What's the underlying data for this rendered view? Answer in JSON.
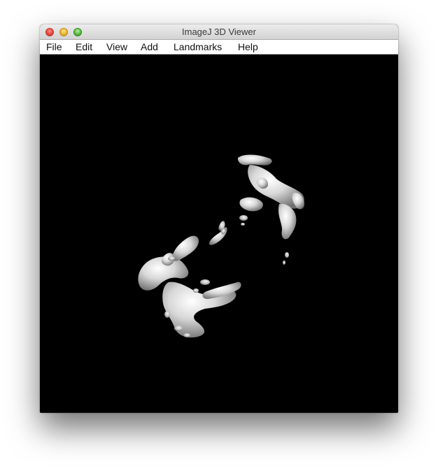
{
  "window": {
    "title": "ImageJ 3D Viewer"
  },
  "menubar": {
    "items": [
      {
        "label": "File"
      },
      {
        "label": "Edit"
      },
      {
        "label": "View"
      },
      {
        "label": "Add"
      },
      {
        "label": "Landmarks"
      },
      {
        "label": "Help"
      }
    ]
  },
  "viewport": {
    "background_color": "#000000",
    "surface_color": "#e6e6e6"
  }
}
